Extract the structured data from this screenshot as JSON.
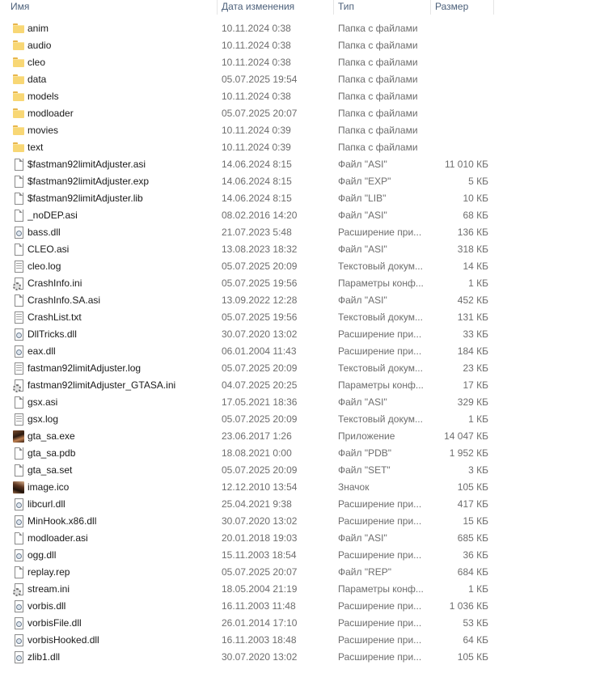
{
  "columns": {
    "name": "Имя",
    "date": "Дата изменения",
    "type": "Тип",
    "size": "Размер"
  },
  "files": [
    {
      "name": "anim",
      "date": "10.11.2024 0:38",
      "type": "Папка с файлами",
      "size": "",
      "icon": "folder-icon"
    },
    {
      "name": "audio",
      "date": "10.11.2024 0:38",
      "type": "Папка с файлами",
      "size": "",
      "icon": "folder-icon"
    },
    {
      "name": "cleo",
      "date": "10.11.2024 0:38",
      "type": "Папка с файлами",
      "size": "",
      "icon": "folder-icon"
    },
    {
      "name": "data",
      "date": "05.07.2025 19:54",
      "type": "Папка с файлами",
      "size": "",
      "icon": "folder-icon"
    },
    {
      "name": "models",
      "date": "10.11.2024 0:38",
      "type": "Папка с файлами",
      "size": "",
      "icon": "folder-icon"
    },
    {
      "name": "modloader",
      "date": "05.07.2025 20:07",
      "type": "Папка с файлами",
      "size": "",
      "icon": "folder-icon"
    },
    {
      "name": "movies",
      "date": "10.11.2024 0:39",
      "type": "Папка с файлами",
      "size": "",
      "icon": "folder-icon"
    },
    {
      "name": "text",
      "date": "10.11.2024 0:39",
      "type": "Папка с файлами",
      "size": "",
      "icon": "folder-icon"
    },
    {
      "name": "$fastman92limitAdjuster.asi",
      "date": "14.06.2024 8:15",
      "type": "Файл \"ASI\"",
      "size": "11 010 КБ",
      "icon": "file-icon"
    },
    {
      "name": "$fastman92limitAdjuster.exp",
      "date": "14.06.2024 8:15",
      "type": "Файл \"EXP\"",
      "size": "5 КБ",
      "icon": "file-icon"
    },
    {
      "name": "$fastman92limitAdjuster.lib",
      "date": "14.06.2024 8:15",
      "type": "Файл \"LIB\"",
      "size": "10 КБ",
      "icon": "file-icon"
    },
    {
      "name": "_noDEP.asi",
      "date": "08.02.2016 14:20",
      "type": "Файл \"ASI\"",
      "size": "68 КБ",
      "icon": "file-icon"
    },
    {
      "name": "bass.dll",
      "date": "21.07.2023 5:48",
      "type": "Расширение при...",
      "size": "136 КБ",
      "icon": "dll-icon"
    },
    {
      "name": "CLEO.asi",
      "date": "13.08.2023 18:32",
      "type": "Файл \"ASI\"",
      "size": "318 КБ",
      "icon": "file-icon"
    },
    {
      "name": "cleo.log",
      "date": "05.07.2025 20:09",
      "type": "Текстовый докум...",
      "size": "14 КБ",
      "icon": "text-file-icon"
    },
    {
      "name": "CrashInfo.ini",
      "date": "05.07.2025 19:56",
      "type": "Параметры конф...",
      "size": "1 КБ",
      "icon": "settings-file-icon"
    },
    {
      "name": "CrashInfo.SA.asi",
      "date": "13.09.2022 12:28",
      "type": "Файл \"ASI\"",
      "size": "452 КБ",
      "icon": "file-icon"
    },
    {
      "name": "CrashList.txt",
      "date": "05.07.2025 19:56",
      "type": "Текстовый докум...",
      "size": "131 КБ",
      "icon": "text-file-icon"
    },
    {
      "name": "DllTricks.dll",
      "date": "30.07.2020 13:02",
      "type": "Расширение при...",
      "size": "33 КБ",
      "icon": "dll-icon"
    },
    {
      "name": "eax.dll",
      "date": "06.01.2004 11:43",
      "type": "Расширение при...",
      "size": "184 КБ",
      "icon": "dll-icon"
    },
    {
      "name": "fastman92limitAdjuster.log",
      "date": "05.07.2025 20:09",
      "type": "Текстовый докум...",
      "size": "23 КБ",
      "icon": "text-file-icon"
    },
    {
      "name": "fastman92limitAdjuster_GTASA.ini",
      "date": "04.07.2025 20:25",
      "type": "Параметры конф...",
      "size": "17 КБ",
      "icon": "settings-file-icon"
    },
    {
      "name": "gsx.asi",
      "date": "17.05.2021 18:36",
      "type": "Файл \"ASI\"",
      "size": "329 КБ",
      "icon": "file-icon"
    },
    {
      "name": "gsx.log",
      "date": "05.07.2025 20:09",
      "type": "Текстовый докум...",
      "size": "1 КБ",
      "icon": "text-file-icon"
    },
    {
      "name": "gta_sa.exe",
      "date": "23.06.2017 1:26",
      "type": "Приложение",
      "size": "14 047 КБ",
      "icon": "application-icon"
    },
    {
      "name": "gta_sa.pdb",
      "date": "18.08.2021 0:00",
      "type": "Файл \"PDB\"",
      "size": "1 952 КБ",
      "icon": "file-icon"
    },
    {
      "name": "gta_sa.set",
      "date": "05.07.2025 20:09",
      "type": "Файл \"SET\"",
      "size": "3 КБ",
      "icon": "file-icon"
    },
    {
      "name": "image.ico",
      "date": "12.12.2010 13:54",
      "type": "Значок",
      "size": "105 КБ",
      "icon": "image-icon"
    },
    {
      "name": "libcurl.dll",
      "date": "25.04.2021 9:38",
      "type": "Расширение при...",
      "size": "417 КБ",
      "icon": "dll-icon"
    },
    {
      "name": "MinHook.x86.dll",
      "date": "30.07.2020 13:02",
      "type": "Расширение при...",
      "size": "15 КБ",
      "icon": "dll-icon"
    },
    {
      "name": "modloader.asi",
      "date": "20.01.2018 19:03",
      "type": "Файл \"ASI\"",
      "size": "685 КБ",
      "icon": "file-icon"
    },
    {
      "name": "ogg.dll",
      "date": "15.11.2003 18:54",
      "type": "Расширение при...",
      "size": "36 КБ",
      "icon": "dll-icon"
    },
    {
      "name": "replay.rep",
      "date": "05.07.2025 20:07",
      "type": "Файл \"REP\"",
      "size": "684 КБ",
      "icon": "file-icon"
    },
    {
      "name": "stream.ini",
      "date": "18.05.2004 21:19",
      "type": "Параметры конф...",
      "size": "1 КБ",
      "icon": "settings-file-icon"
    },
    {
      "name": "vorbis.dll",
      "date": "16.11.2003 11:48",
      "type": "Расширение при...",
      "size": "1 036 КБ",
      "icon": "dll-icon"
    },
    {
      "name": "vorbisFile.dll",
      "date": "26.01.2014 17:10",
      "type": "Расширение при...",
      "size": "53 КБ",
      "icon": "dll-icon"
    },
    {
      "name": "vorbisHooked.dll",
      "date": "16.11.2003 18:48",
      "type": "Расширение при...",
      "size": "64 КБ",
      "icon": "dll-icon"
    },
    {
      "name": "zlib1.dll",
      "date": "30.07.2020 13:02",
      "type": "Расширение при...",
      "size": "105 КБ",
      "icon": "dll-icon"
    }
  ]
}
